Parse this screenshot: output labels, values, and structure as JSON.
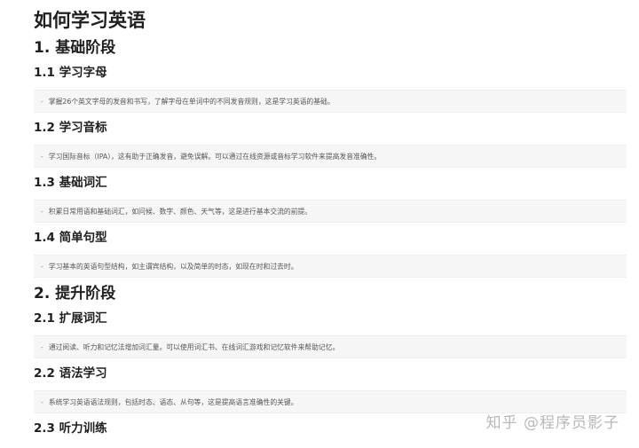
{
  "title": "如何学习英语",
  "sections": [
    {
      "heading": "1. 基础阶段",
      "subsections": [
        {
          "heading": "1.1 学习字母",
          "bullet": "掌握26个英文字母的发音和书写，了解字母在单词中的不同发音规则，这是学习英语的基础。"
        },
        {
          "heading": "1.2 学习音标",
          "bullet": "学习国际音标（IPA），这有助于正确发音，避免误解。可以通过在线资源或音标学习软件来提高发音准确性。"
        },
        {
          "heading": "1.3 基础词汇",
          "bullet": "积累日常用语和基础词汇，如问候、数字、颜色、天气等，这是进行基本交流的前提。"
        },
        {
          "heading": "1.4 简单句型",
          "bullet": "学习基本的英语句型结构，如主谓宾结构，以及简单的时态，如现在时和过去时。"
        }
      ]
    },
    {
      "heading": "2. 提升阶段",
      "subsections": [
        {
          "heading": "2.1 扩展词汇",
          "bullet": "通过阅读、听力和记忆法增加词汇量。可以使用词汇书、在线词汇游戏和记忆软件来帮助记忆。"
        },
        {
          "heading": "2.2 语法学习",
          "bullet": "系统学习英语语法规则，包括时态、语态、从句等，这是提高语言准确性的关键。"
        },
        {
          "heading": "2.3 听力训练",
          "bullet": ""
        }
      ]
    }
  ],
  "bullet_dash": "-",
  "watermark": "知乎 @程序员影子"
}
